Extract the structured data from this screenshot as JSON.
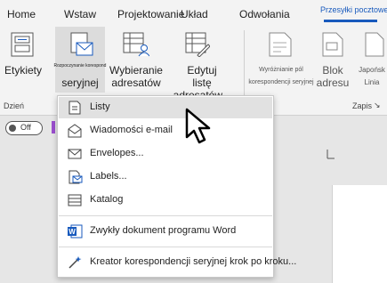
{
  "tabs": {
    "home": "Home",
    "insert": "Wstaw",
    "design": "Projektowanie",
    "layout": "Układ",
    "references": "Odwołania",
    "mailings": "Przesyłki pocztowe"
  },
  "ribbon": {
    "labels_btn": "Etykiety",
    "start_merge_top": "Rozpoczynanie korespond",
    "start_merge_bottom": "seryjnej",
    "select_recipients_1": "Wybieranie",
    "select_recipients_2": "adresatów",
    "edit_list_1": "Edytuj",
    "edit_list_2": "listę adresatów...",
    "highlight_1": "Wyróżnianie pól",
    "highlight_2": "korespondencji seryjnej",
    "address_block_1": "Blok",
    "address_block_2": "adresu",
    "japanese_1": "Japońsk",
    "japanese_2": "Linia",
    "group_left": "Dzień",
    "group_right": "Zapis",
    "toggle_text": "Off"
  },
  "menu": {
    "items": [
      {
        "label": "Listy",
        "icon": "letter-icon"
      },
      {
        "label": "Wiadomości e-mail",
        "icon": "email-envelope-icon"
      },
      {
        "label": "Envelopes...",
        "icon": "envelope-icon"
      },
      {
        "label": "Labels...",
        "icon": "labels-icon"
      },
      {
        "label": "Katalog",
        "icon": "directory-icon"
      },
      {
        "label": "Zwykły dokument programu Word",
        "icon": "word-document-icon"
      },
      {
        "label": "Kreator korespondencji seryjnej krok po kroku...",
        "icon": "wizard-icon"
      }
    ]
  },
  "colors": {
    "accent": "#185abd",
    "menu_highlight": "#e1e1e1",
    "word_blue": "#185abd"
  }
}
